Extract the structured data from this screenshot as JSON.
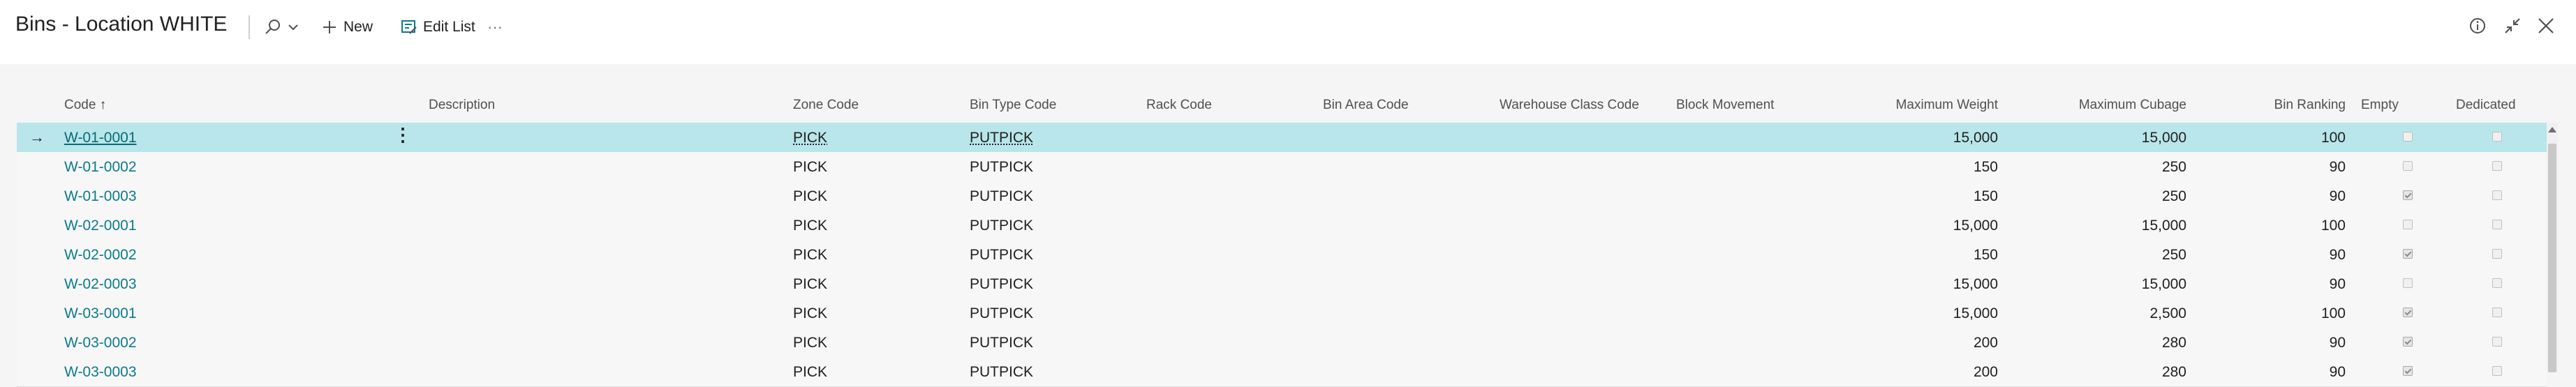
{
  "page": {
    "title": "Bins - Location WHITE",
    "toolbar": {
      "new_label": "New",
      "edit_list_label": "Edit List",
      "more_label": "···"
    }
  },
  "columns": {
    "code": "Code",
    "code_sort": "↑",
    "description": "Description",
    "zone_code": "Zone Code",
    "bin_type_code": "Bin Type Code",
    "rack_code": "Rack Code",
    "bin_area_code": "Bin Area Code",
    "warehouse_class_code": "Warehouse Class Code",
    "block_movement": "Block Movement",
    "maximum_weight": "Maximum Weight",
    "maximum_cubage": "Maximum Cubage",
    "bin_ranking": "Bin Ranking",
    "empty": "Empty",
    "dedicated": "Dedicated"
  },
  "rows": [
    {
      "code": "W-01-0001",
      "zone": "PICK",
      "bin_type": "PUTPICK",
      "max_weight": "15,000",
      "max_cubage": "15,000",
      "ranking": "100",
      "empty": false,
      "dedicated": false
    },
    {
      "code": "W-01-0002",
      "zone": "PICK",
      "bin_type": "PUTPICK",
      "max_weight": "150",
      "max_cubage": "250",
      "ranking": "90",
      "empty": false,
      "dedicated": false
    },
    {
      "code": "W-01-0003",
      "zone": "PICK",
      "bin_type": "PUTPICK",
      "max_weight": "150",
      "max_cubage": "250",
      "ranking": "90",
      "empty": true,
      "dedicated": false
    },
    {
      "code": "W-02-0001",
      "zone": "PICK",
      "bin_type": "PUTPICK",
      "max_weight": "15,000",
      "max_cubage": "15,000",
      "ranking": "100",
      "empty": false,
      "dedicated": false
    },
    {
      "code": "W-02-0002",
      "zone": "PICK",
      "bin_type": "PUTPICK",
      "max_weight": "150",
      "max_cubage": "250",
      "ranking": "90",
      "empty": true,
      "dedicated": false
    },
    {
      "code": "W-02-0003",
      "zone": "PICK",
      "bin_type": "PUTPICK",
      "max_weight": "15,000",
      "max_cubage": "15,000",
      "ranking": "90",
      "empty": false,
      "dedicated": false
    },
    {
      "code": "W-03-0001",
      "zone": "PICK",
      "bin_type": "PUTPICK",
      "max_weight": "15,000",
      "max_cubage": "2,500",
      "ranking": "100",
      "empty": true,
      "dedicated": false
    },
    {
      "code": "W-03-0002",
      "zone": "PICK",
      "bin_type": "PUTPICK",
      "max_weight": "200",
      "max_cubage": "280",
      "ranking": "90",
      "empty": true,
      "dedicated": false
    },
    {
      "code": "W-03-0003",
      "zone": "PICK",
      "bin_type": "PUTPICK",
      "max_weight": "200",
      "max_cubage": "280",
      "ranking": "90",
      "empty": true,
      "dedicated": false
    }
  ],
  "colors": {
    "selected_row": "#b8e6ea",
    "link": "#0b7c88",
    "background": "#f5f5f5"
  },
  "icons": [
    "search-icon",
    "chevron-down-icon",
    "plus-icon",
    "edit-list-icon",
    "info-icon",
    "collapse-icon",
    "close-icon",
    "row-arrow-icon",
    "row-menu-icon"
  ]
}
